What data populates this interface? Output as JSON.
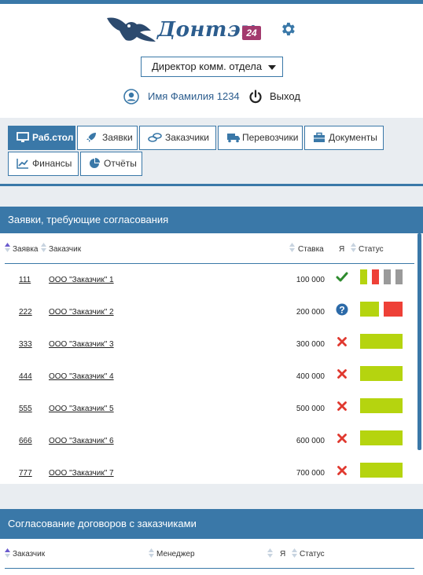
{
  "header": {
    "logo_text": "Донтэк",
    "logo_badge": "24",
    "role_select": "Директор комм. отдела",
    "user_name": "Имя Фамилия 1234",
    "logout_label": "Выход"
  },
  "nav": {
    "tabs": [
      {
        "label": "Раб.стол",
        "icon": "monitor-icon",
        "active": true
      },
      {
        "label": "Заявки",
        "icon": "rocket-icon"
      },
      {
        "label": "Заказчики",
        "icon": "coins-icon"
      },
      {
        "label": "Перевозчики",
        "icon": "truck-icon"
      },
      {
        "label": "Документы",
        "icon": "briefcase-icon"
      },
      {
        "label": "Финансы",
        "icon": "line-chart-icon"
      },
      {
        "label": "Отчёты",
        "icon": "pie-chart-icon"
      }
    ]
  },
  "requests_panel": {
    "title": "Заявки, требующие согласования",
    "columns": [
      "Заявка",
      "Заказчик",
      "Ставка",
      "Я",
      "Статус"
    ],
    "rows": [
      {
        "num": "111",
        "customer": "ООО \"Заказчик\" 1",
        "rate": "100 000",
        "me": "check",
        "status": [
          "#b5d40f",
          "#ee4037",
          "#9a9a9a",
          "#9a9a9a"
        ]
      },
      {
        "num": "222",
        "customer": "ООО \"Заказчик\" 2",
        "rate": "200 000",
        "me": "question",
        "status": [
          "#b5d40f",
          "#ee4037"
        ]
      },
      {
        "num": "333",
        "customer": "ООО \"Заказчик\" 3",
        "rate": "300 000",
        "me": "cross",
        "status": [
          "#b5d40f"
        ]
      },
      {
        "num": "444",
        "customer": "ООО \"Заказчик\" 4",
        "rate": "400 000",
        "me": "cross",
        "status": [
          "#b5d40f"
        ]
      },
      {
        "num": "555",
        "customer": "ООО \"Заказчик\" 5",
        "rate": "500 000",
        "me": "cross",
        "status": [
          "#b5d40f"
        ]
      },
      {
        "num": "666",
        "customer": "ООО \"Заказчик\" 6",
        "rate": "600 000",
        "me": "cross",
        "status": [
          "#b5d40f"
        ]
      },
      {
        "num": "777",
        "customer": "ООО \"Заказчик\" 7",
        "rate": "700 000",
        "me": "cross",
        "status": [
          "#b5d40f"
        ]
      }
    ]
  },
  "contracts_panel": {
    "title": "Согласование договоров с заказчиками",
    "columns": [
      "Заказчик",
      "Менеджер",
      "Я",
      "Статус"
    ]
  },
  "colors": {
    "accent": "#3a78a8",
    "approve": "#2e8b2e",
    "reject": "#e0392f",
    "question": "#2c6aa8",
    "status_green": "#b5d40f",
    "status_red": "#ee4037",
    "status_gray": "#9a9a9a"
  }
}
